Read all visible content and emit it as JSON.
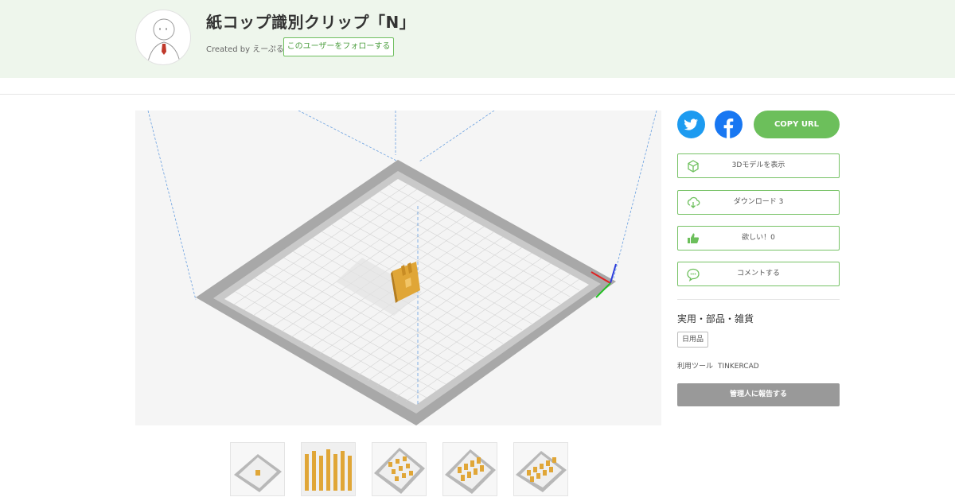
{
  "header": {
    "title": "紙コップ識別クリップ「N」",
    "created_by": "Created by えーぷる",
    "follow_label": "このユーザーをフォローする"
  },
  "share": {
    "twitter_icon": "twitter-bird-icon",
    "facebook_icon": "facebook-f-icon",
    "copy_url_label": "COPY URL",
    "twitter_color": "#1d9bf0",
    "facebook_color": "#1877f2",
    "accent_color": "#6cbf5b"
  },
  "actions": [
    {
      "icon": "cube-icon",
      "label": "3Dモデルを表示"
    },
    {
      "icon": "cloud-download-icon",
      "label": "ダウンロード 3"
    },
    {
      "icon": "thumbs-up-icon",
      "label": "欲しい！0"
    },
    {
      "icon": "speech-bubble-icon",
      "label": "コメントする"
    }
  ],
  "info": {
    "category": "実用・部品・雑貨",
    "tag": "日用品",
    "tool_label": "利用ツール",
    "tool_value": "TINKERCAD",
    "report_label": "管理人に報告する"
  },
  "thumbnails": [
    {
      "name": "single-clip"
    },
    {
      "name": "clip-array-front"
    },
    {
      "name": "clip-array-grid"
    },
    {
      "name": "clip-array-angle"
    },
    {
      "name": "clip-array-side"
    }
  ]
}
